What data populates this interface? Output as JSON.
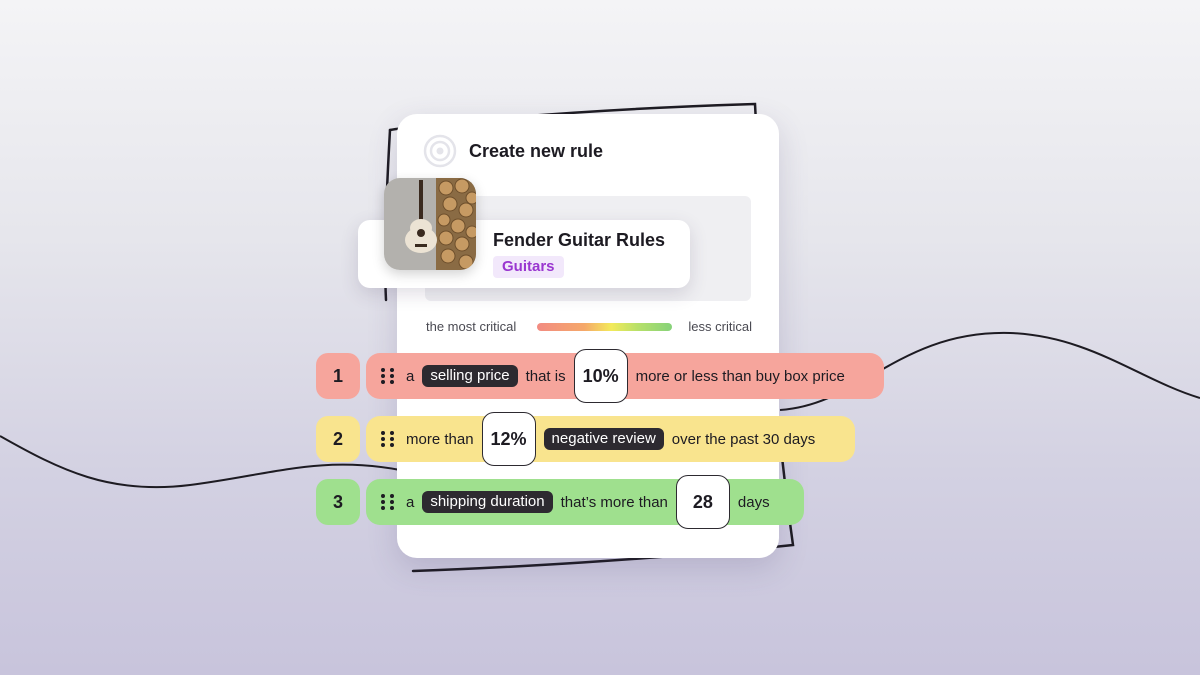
{
  "card": {
    "title": "Create new rule",
    "icon": "target-icon"
  },
  "product": {
    "name": "Fender Guitar Rules",
    "tag": "Guitars",
    "image": "guitar-thumbnail"
  },
  "scale": {
    "left_label": "the most critical",
    "right_label": "less critical",
    "colors": [
      "#f28b82",
      "#f3ea5a",
      "#86d27a"
    ]
  },
  "rules": [
    {
      "number": "1",
      "color": "#f6a59c",
      "word_a": "a",
      "pill": "selling price",
      "text_mid": "that is",
      "value": "10%",
      "text_end": "more or less than buy box price"
    },
    {
      "number": "2",
      "color": "#f9e48e",
      "text_start": "more than",
      "value": "12%",
      "pill": "negative review",
      "text_end": "over the past 30 days"
    },
    {
      "number": "3",
      "color": "#9fe08e",
      "word_a": "a",
      "pill": "shipping duration",
      "text_mid": "that’s more than",
      "value": "28",
      "text_end": "days"
    }
  ]
}
